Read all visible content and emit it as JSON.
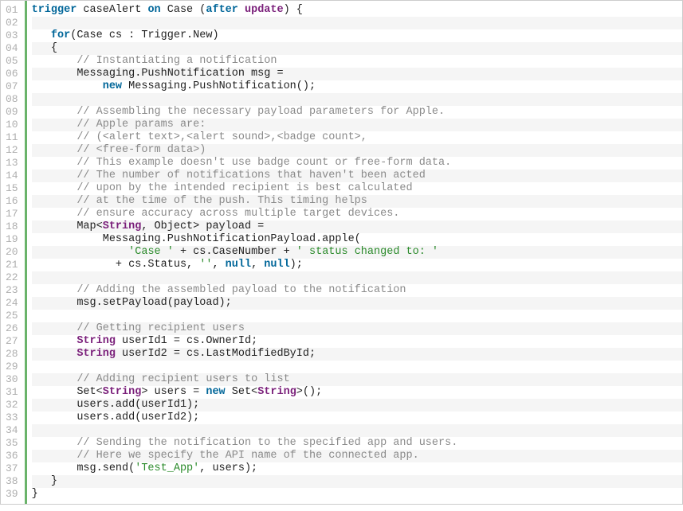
{
  "code": {
    "lineCount": 39,
    "lines": [
      [
        {
          "t": "kw",
          "s": "trigger"
        },
        {
          "t": "p",
          "s": " caseAlert "
        },
        {
          "t": "kw",
          "s": "on"
        },
        {
          "t": "p",
          "s": " Case ("
        },
        {
          "t": "kw",
          "s": "after"
        },
        {
          "t": "p",
          "s": " "
        },
        {
          "t": "ty",
          "s": "update"
        },
        {
          "t": "p",
          "s": ") {"
        }
      ],
      [
        {
          "t": "p",
          "s": " "
        }
      ],
      [
        {
          "t": "p",
          "s": "   "
        },
        {
          "t": "kw",
          "s": "for"
        },
        {
          "t": "p",
          "s": "(Case cs : Trigger.New)"
        }
      ],
      [
        {
          "t": "p",
          "s": "   {"
        }
      ],
      [
        {
          "t": "p",
          "s": "       "
        },
        {
          "t": "cmt",
          "s": "// Instantiating a notification"
        }
      ],
      [
        {
          "t": "p",
          "s": "       Messaging.PushNotification msg ="
        }
      ],
      [
        {
          "t": "p",
          "s": "           "
        },
        {
          "t": "kw",
          "s": "new"
        },
        {
          "t": "p",
          "s": " Messaging.PushNotification();"
        }
      ],
      [
        {
          "t": "p",
          "s": " "
        }
      ],
      [
        {
          "t": "p",
          "s": "       "
        },
        {
          "t": "cmt",
          "s": "// Assembling the necessary payload parameters for Apple."
        }
      ],
      [
        {
          "t": "p",
          "s": "       "
        },
        {
          "t": "cmt",
          "s": "// Apple params are:"
        }
      ],
      [
        {
          "t": "p",
          "s": "       "
        },
        {
          "t": "cmt",
          "s": "// (<alert text>,<alert sound>,<badge count>,"
        }
      ],
      [
        {
          "t": "p",
          "s": "       "
        },
        {
          "t": "cmt",
          "s": "// <free-form data>)"
        }
      ],
      [
        {
          "t": "p",
          "s": "       "
        },
        {
          "t": "cmt",
          "s": "// This example doesn't use badge count or free-form data."
        }
      ],
      [
        {
          "t": "p",
          "s": "       "
        },
        {
          "t": "cmt",
          "s": "// The number of notifications that haven't been acted"
        }
      ],
      [
        {
          "t": "p",
          "s": "       "
        },
        {
          "t": "cmt",
          "s": "// upon by the intended recipient is best calculated"
        }
      ],
      [
        {
          "t": "p",
          "s": "       "
        },
        {
          "t": "cmt",
          "s": "// at the time of the push. This timing helps"
        }
      ],
      [
        {
          "t": "p",
          "s": "       "
        },
        {
          "t": "cmt",
          "s": "// ensure accuracy across multiple target devices."
        }
      ],
      [
        {
          "t": "p",
          "s": "       Map<"
        },
        {
          "t": "ty",
          "s": "String"
        },
        {
          "t": "p",
          "s": ", Object> payload ="
        }
      ],
      [
        {
          "t": "p",
          "s": "           Messaging.PushNotificationPayload.apple("
        }
      ],
      [
        {
          "t": "p",
          "s": "               "
        },
        {
          "t": "str",
          "s": "'Case '"
        },
        {
          "t": "p",
          "s": " + cs.CaseNumber + "
        },
        {
          "t": "str",
          "s": "' status changed to: '"
        }
      ],
      [
        {
          "t": "p",
          "s": "             + cs.Status, "
        },
        {
          "t": "str",
          "s": "''"
        },
        {
          "t": "p",
          "s": ", "
        },
        {
          "t": "lit",
          "s": "null"
        },
        {
          "t": "p",
          "s": ", "
        },
        {
          "t": "lit",
          "s": "null"
        },
        {
          "t": "p",
          "s": ");"
        }
      ],
      [
        {
          "t": "p",
          "s": " "
        }
      ],
      [
        {
          "t": "p",
          "s": "       "
        },
        {
          "t": "cmt",
          "s": "// Adding the assembled payload to the notification"
        }
      ],
      [
        {
          "t": "p",
          "s": "       msg.setPayload(payload);"
        }
      ],
      [
        {
          "t": "p",
          "s": " "
        }
      ],
      [
        {
          "t": "p",
          "s": "       "
        },
        {
          "t": "cmt",
          "s": "// Getting recipient users"
        }
      ],
      [
        {
          "t": "p",
          "s": "       "
        },
        {
          "t": "ty",
          "s": "String"
        },
        {
          "t": "p",
          "s": " userId1 = cs.OwnerId;"
        }
      ],
      [
        {
          "t": "p",
          "s": "       "
        },
        {
          "t": "ty",
          "s": "String"
        },
        {
          "t": "p",
          "s": " userId2 = cs.LastModifiedById;"
        }
      ],
      [
        {
          "t": "p",
          "s": " "
        }
      ],
      [
        {
          "t": "p",
          "s": "       "
        },
        {
          "t": "cmt",
          "s": "// Adding recipient users to list"
        }
      ],
      [
        {
          "t": "p",
          "s": "       Set<"
        },
        {
          "t": "ty",
          "s": "String"
        },
        {
          "t": "p",
          "s": "> users = "
        },
        {
          "t": "kw",
          "s": "new"
        },
        {
          "t": "p",
          "s": " Set<"
        },
        {
          "t": "ty",
          "s": "String"
        },
        {
          "t": "p",
          "s": ">();"
        }
      ],
      [
        {
          "t": "p",
          "s": "       users.add(userId1);"
        }
      ],
      [
        {
          "t": "p",
          "s": "       users.add(userId2);"
        }
      ],
      [
        {
          "t": "p",
          "s": " "
        }
      ],
      [
        {
          "t": "p",
          "s": "       "
        },
        {
          "t": "cmt",
          "s": "// Sending the notification to the specified app and users."
        }
      ],
      [
        {
          "t": "p",
          "s": "       "
        },
        {
          "t": "cmt",
          "s": "// Here we specify the API name of the connected app."
        }
      ],
      [
        {
          "t": "p",
          "s": "       msg.send("
        },
        {
          "t": "str",
          "s": "'Test_App'"
        },
        {
          "t": "p",
          "s": ", users);"
        }
      ],
      [
        {
          "t": "p",
          "s": "   }"
        }
      ],
      [
        {
          "t": "p",
          "s": "}"
        }
      ]
    ]
  }
}
